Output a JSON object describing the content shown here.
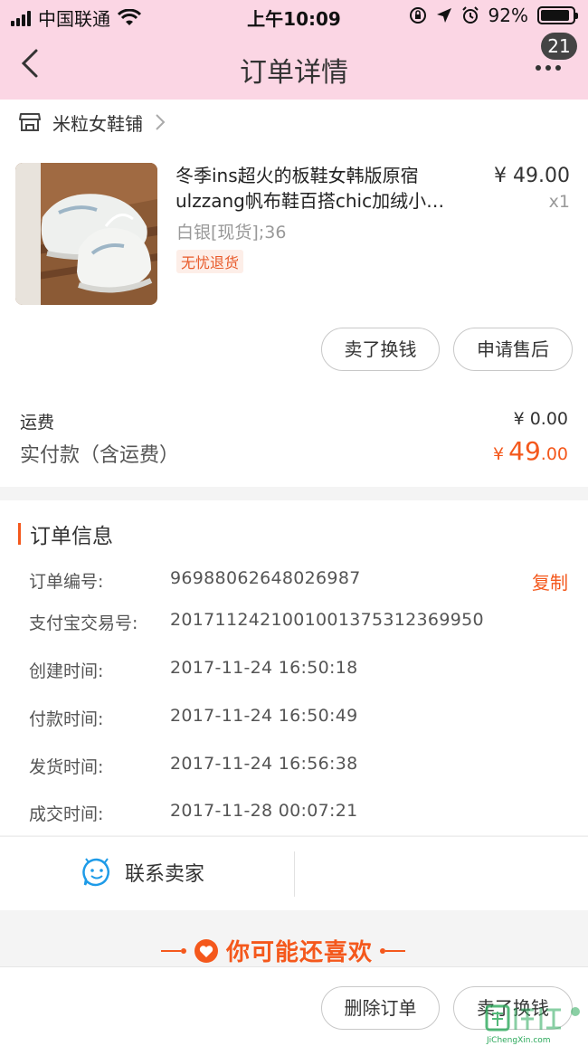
{
  "status_bar": {
    "carrier": "中国联通",
    "time": "上午10:09",
    "battery": "92%",
    "battery_level": 0.92
  },
  "nav": {
    "title": "订单详情",
    "badge_count": "21"
  },
  "shop": {
    "name": "米粒女鞋铺"
  },
  "product": {
    "title": "冬季ins超火的板鞋女韩版原宿ulzzang帆布鞋百搭chic加绒小…",
    "price": "¥ 49.00",
    "quantity": "x1",
    "spec": "白银[现货];36",
    "tag": "无忧退货"
  },
  "actions": {
    "exchange": "卖了换钱",
    "after_sale": "申请售后",
    "delete": "删除订单"
  },
  "payment": {
    "shipping_label": "运费",
    "shipping_value": "¥ 0.00",
    "paid_label": "实付款（含运费）",
    "paid_currency": "¥",
    "paid_integer": "49",
    "paid_decimal": ".00"
  },
  "order_info": {
    "title": "订单信息",
    "copy_label": "复制",
    "rows": [
      {
        "key": "订单编号:",
        "value": "96988062648026987"
      },
      {
        "key": "支付宝交易号:",
        "value": "2017112421001001375312369950"
      },
      {
        "key": "创建时间:",
        "value": "2017-11-24 16:50:18"
      },
      {
        "key": "付款时间:",
        "value": "2017-11-24 16:50:49"
      },
      {
        "key": "发货时间:",
        "value": "2017-11-24 16:56:38"
      },
      {
        "key": "成交时间:",
        "value": "2017-11-28 00:07:21"
      }
    ]
  },
  "contact": {
    "label": "联系卖家"
  },
  "recommend": {
    "label": "你可能还喜欢"
  },
  "watermark": {
    "text": "JiChengXin.com"
  }
}
